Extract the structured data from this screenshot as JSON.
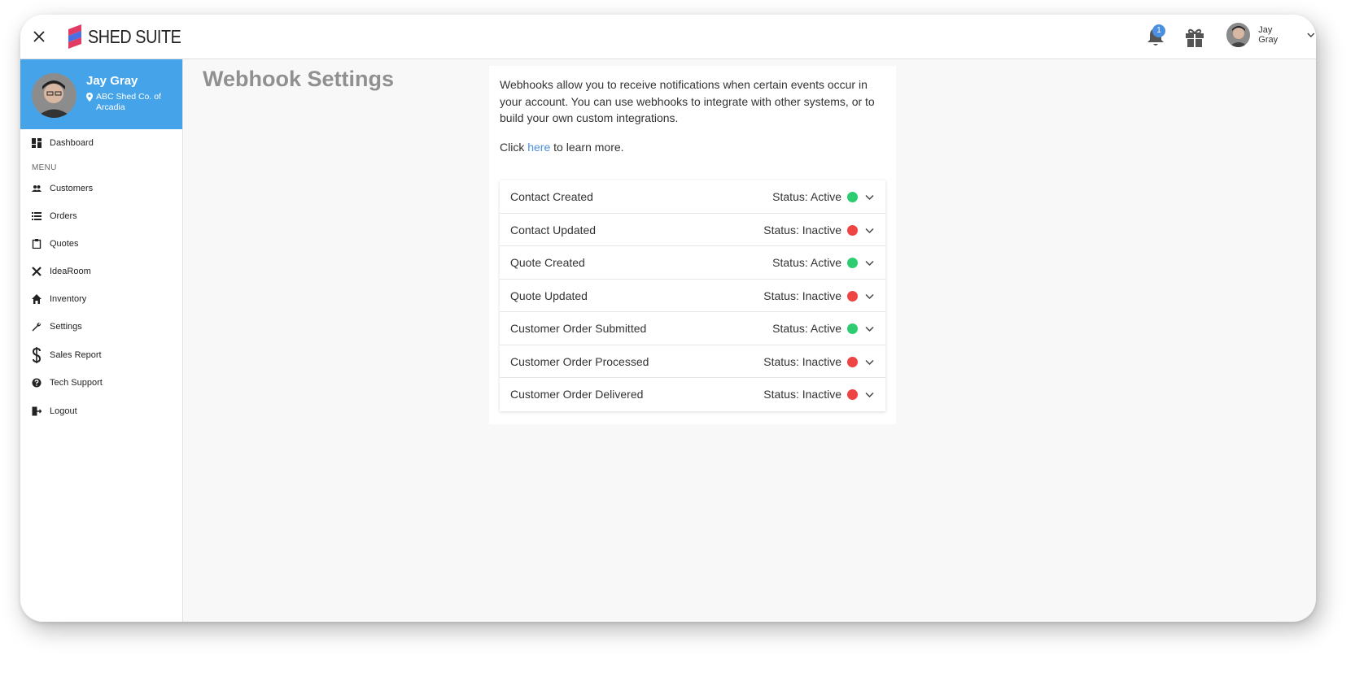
{
  "app": {
    "brand": "SHED SUITE"
  },
  "topbar": {
    "notification_count": "1",
    "user_name": "Jay Gray"
  },
  "sidebar": {
    "profile_name": "Jay Gray",
    "profile_location": "ABC Shed Co. of Arcadia",
    "dashboard_label": "Dashboard",
    "menu_label": "MENU",
    "items": [
      {
        "label": "Customers",
        "icon": "people-icon"
      },
      {
        "label": "Orders",
        "icon": "list-icon"
      },
      {
        "label": "Quotes",
        "icon": "clipboard-icon"
      },
      {
        "label": "IdeaRoom",
        "icon": "tools-icon"
      },
      {
        "label": "Inventory",
        "icon": "home-icon"
      },
      {
        "label": "Settings",
        "icon": "wrench-icon"
      },
      {
        "label": "Sales Report",
        "icon": "dollar-icon"
      },
      {
        "label": "Tech Support",
        "icon": "help-icon"
      },
      {
        "label": "Logout",
        "icon": "logout-icon"
      }
    ]
  },
  "main": {
    "title": "Webhook Settings",
    "intro": "Webhooks allow you to receive notifications when certain events occur in your account. You can use webhooks to integrate with other systems, or to build your own custom integrations.",
    "learn_prefix": "Click ",
    "learn_link": "here",
    "learn_suffix": " to learn more.",
    "webhooks": [
      {
        "name": "Contact Created",
        "status": "Status: Active",
        "active": true
      },
      {
        "name": "Contact Updated",
        "status": "Status: Inactive",
        "active": false
      },
      {
        "name": "Quote Created",
        "status": "Status: Active",
        "active": true
      },
      {
        "name": "Quote Updated",
        "status": "Status: Inactive",
        "active": false
      },
      {
        "name": "Customer Order Submitted",
        "status": "Status: Active",
        "active": true
      },
      {
        "name": "Customer Order Processed",
        "status": "Status: Inactive",
        "active": false
      },
      {
        "name": "Customer Order Delivered",
        "status": "Status: Inactive",
        "active": false
      }
    ]
  },
  "colors": {
    "accent": "#45a3ea",
    "active": "#2ecc71",
    "inactive": "#ef4444",
    "link": "#4a8fe0"
  }
}
